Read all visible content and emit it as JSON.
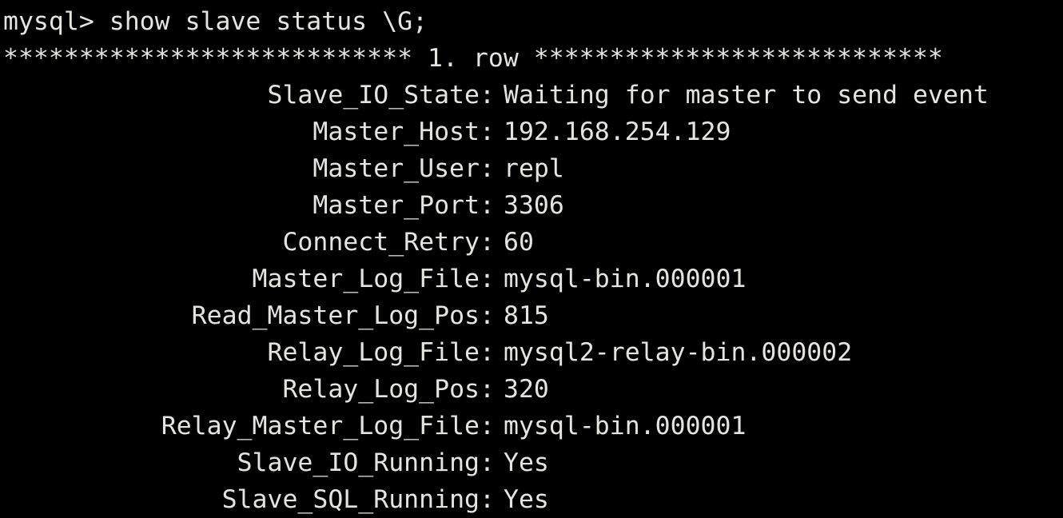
{
  "terminal": {
    "background_color": "#000000",
    "text_color": "#e6e4de",
    "prompt": "mysql>",
    "command": "show slave status \\G;",
    "command_line": "mysql> show slave status \\G;",
    "row_banner": "*************************** 1. row ***************************",
    "row_banner_left_stars": "***************************",
    "row_banner_label": "1. row",
    "row_banner_right_stars": "***************************",
    "separator": ": "
  },
  "result": {
    "row_number": "1",
    "fields": [
      {
        "label": "Slave_IO_State",
        "value": "Waiting for master to send event"
      },
      {
        "label": "Master_Host",
        "value": "192.168.254.129"
      },
      {
        "label": "Master_User",
        "value": "repl"
      },
      {
        "label": "Master_Port",
        "value": "3306"
      },
      {
        "label": "Connect_Retry",
        "value": "60"
      },
      {
        "label": "Master_Log_File",
        "value": "mysql-bin.000001"
      },
      {
        "label": "Read_Master_Log_Pos",
        "value": "815"
      },
      {
        "label": "Relay_Log_File",
        "value": "mysql2-relay-bin.000002"
      },
      {
        "label": "Relay_Log_Pos",
        "value": "320"
      },
      {
        "label": "Relay_Master_Log_File",
        "value": "mysql-bin.000001"
      },
      {
        "label": "Slave_IO_Running",
        "value": "Yes"
      },
      {
        "label": "Slave_SQL_Running",
        "value": "Yes"
      }
    ]
  }
}
